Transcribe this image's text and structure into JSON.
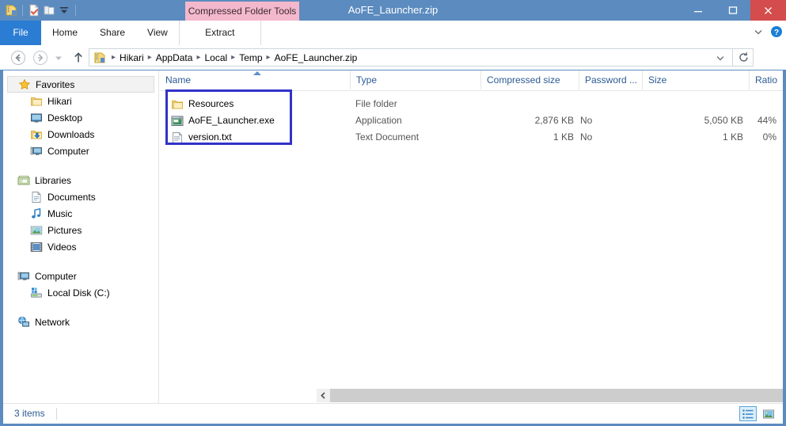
{
  "window": {
    "title": "AoFE_Launcher.zip",
    "accent_color": "#5b8bbf",
    "close_color": "#d44c4c",
    "minimize_label": "–",
    "maximize_label": "❐",
    "close_label": "✕"
  },
  "quick_access": {
    "items": [
      {
        "name": "zip-archive-icon",
        "label": "AoFE_Launcher.zip"
      },
      {
        "name": "properties-icon",
        "label": "Properties"
      },
      {
        "name": "new-folder-icon",
        "label": "New folder"
      },
      {
        "name": "customize-qat-dropdown-icon",
        "label": "Customize Quick Access Toolbar"
      }
    ]
  },
  "ribbon": {
    "contextual_header": "Compressed Folder Tools",
    "contextual_color": "#f4b8cd",
    "tabs": [
      {
        "label": "File",
        "selected": true,
        "kind": "file"
      },
      {
        "label": "Home",
        "selected": false,
        "kind": "normal"
      },
      {
        "label": "Share",
        "selected": false,
        "kind": "normal"
      },
      {
        "label": "View",
        "selected": false,
        "kind": "normal"
      },
      {
        "label": "Extract",
        "selected": false,
        "kind": "contextual"
      }
    ],
    "minimize_ribbon_label": "⌄",
    "help_label": "?"
  },
  "address_bar": {
    "back_label": "←",
    "forward_label": "→",
    "recent_label": "▾",
    "up_label": "↑",
    "icon": "zip-archive-icon",
    "breadcrumbs": [
      "Hikari",
      "AppData",
      "Local",
      "Temp",
      "AoFE_Launcher.zip"
    ],
    "separator": "▸",
    "dropdown_label": "⌄",
    "refresh_label": "⟳"
  },
  "sidebar": {
    "groups": [
      {
        "header": {
          "label": "Favorites",
          "icon": "star-icon",
          "selected": true
        },
        "items": [
          {
            "label": "Hikari",
            "icon": "folder-icon"
          },
          {
            "label": "Desktop",
            "icon": "desktop-icon"
          },
          {
            "label": "Downloads",
            "icon": "downloads-icon"
          },
          {
            "label": "Computer",
            "icon": "computer-icon"
          }
        ]
      },
      {
        "header": {
          "label": "Libraries",
          "icon": "libraries-icon",
          "selected": false
        },
        "items": [
          {
            "label": "Documents",
            "icon": "document-icon"
          },
          {
            "label": "Music",
            "icon": "music-icon"
          },
          {
            "label": "Pictures",
            "icon": "pictures-icon"
          },
          {
            "label": "Videos",
            "icon": "videos-icon"
          }
        ]
      },
      {
        "header": {
          "label": "Computer",
          "icon": "computer-icon",
          "selected": false
        },
        "items": [
          {
            "label": "Local Disk (C:)",
            "icon": "harddisk-icon"
          }
        ]
      },
      {
        "header": {
          "label": "Network",
          "icon": "network-icon",
          "selected": false
        },
        "items": []
      }
    ]
  },
  "file_list": {
    "sort_column": "Name",
    "sort_direction": "ascending",
    "columns": [
      {
        "label": "Name",
        "align": "left"
      },
      {
        "label": "Type",
        "align": "left"
      },
      {
        "label": "Compressed size",
        "align": "left"
      },
      {
        "label": "Password ...",
        "align": "left"
      },
      {
        "label": "Size",
        "align": "left"
      },
      {
        "label": "Ratio",
        "align": "left"
      }
    ],
    "rows": [
      {
        "name": "Resources",
        "icon": "folder-icon",
        "type": "File folder",
        "compressed_size": "",
        "password": "",
        "size": "",
        "ratio": ""
      },
      {
        "name": "AoFE_Launcher.exe",
        "icon": "application-icon",
        "type": "Application",
        "compressed_size": "2,876 KB",
        "password": "No",
        "size": "5,050 KB",
        "ratio": "44%"
      },
      {
        "name": "version.txt",
        "icon": "text-document-icon",
        "type": "Text Document",
        "compressed_size": "1 KB",
        "password": "No",
        "size": "1 KB",
        "ratio": "0%"
      }
    ],
    "annotation": {
      "color": "#3232c8",
      "label": "selection-highlight"
    }
  },
  "scrollbar": {
    "left_arrow": "‹",
    "right_arrow": "›"
  },
  "status_bar": {
    "item_count": "3 items",
    "details_view_label": "Details view",
    "thumbnail_view_label": "Large icons view",
    "active_view": "details"
  }
}
